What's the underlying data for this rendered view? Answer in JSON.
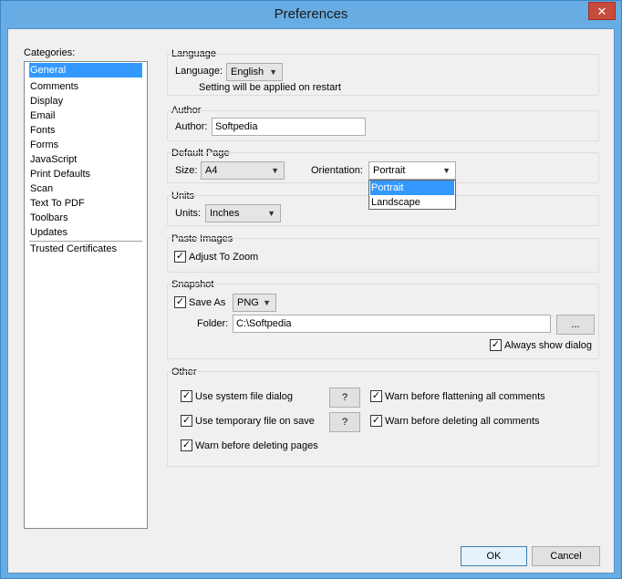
{
  "window": {
    "title": "Preferences",
    "close_glyph": "✕"
  },
  "categories": {
    "label": "Categories:",
    "items": [
      "General",
      "Comments",
      "Display",
      "Email",
      "Fonts",
      "Forms",
      "JavaScript",
      "Print Defaults",
      "Scan",
      "Text To PDF",
      "Toolbars",
      "Updates"
    ],
    "extra_items": [
      "Trusted Certificates"
    ],
    "selected": "General"
  },
  "language": {
    "group_label": "Language",
    "field_label": "Language:",
    "value": "English",
    "note": "Setting will be applied on restart"
  },
  "author": {
    "group_label": "Author",
    "field_label": "Author:",
    "value": "Softpedia"
  },
  "default_page": {
    "group_label": "Default Page",
    "size_label": "Size:",
    "size_value": "A4",
    "orientation_label": "Orientation:",
    "orientation_value": "Portrait",
    "orientation_options": [
      "Portrait",
      "Landscape"
    ]
  },
  "units": {
    "group_label": "Units",
    "field_label": "Units:",
    "value": "Inches"
  },
  "paste_images": {
    "group_label": "Paste Images",
    "adjust_label": "Adjust To Zoom",
    "adjust_checked": true
  },
  "snapshot": {
    "group_label": "Snapshot",
    "save_as_label": "Save As",
    "save_as_checked": true,
    "format": "PNG",
    "folder_label": "Folder:",
    "folder_value": "C:\\Softpedia",
    "browse_label": "...",
    "always_show_label": "Always show dialog",
    "always_show_checked": true
  },
  "other": {
    "group_label": "Other",
    "use_system_dialog": "Use system file dialog",
    "use_temp_file": "Use temporary file on save",
    "warn_deleting_pages": "Warn before deleting pages",
    "warn_flattening": "Warn before flattening all comments",
    "warn_deleting_comments": "Warn before deleting all comments",
    "help_label": "?"
  },
  "buttons": {
    "ok": "OK",
    "cancel": "Cancel"
  },
  "check_glyph": "✓",
  "chevron_glyph": "▼",
  "colors": {
    "accent": "#3399ff",
    "titlebar": "#67ade4",
    "close": "#c74b3d"
  }
}
